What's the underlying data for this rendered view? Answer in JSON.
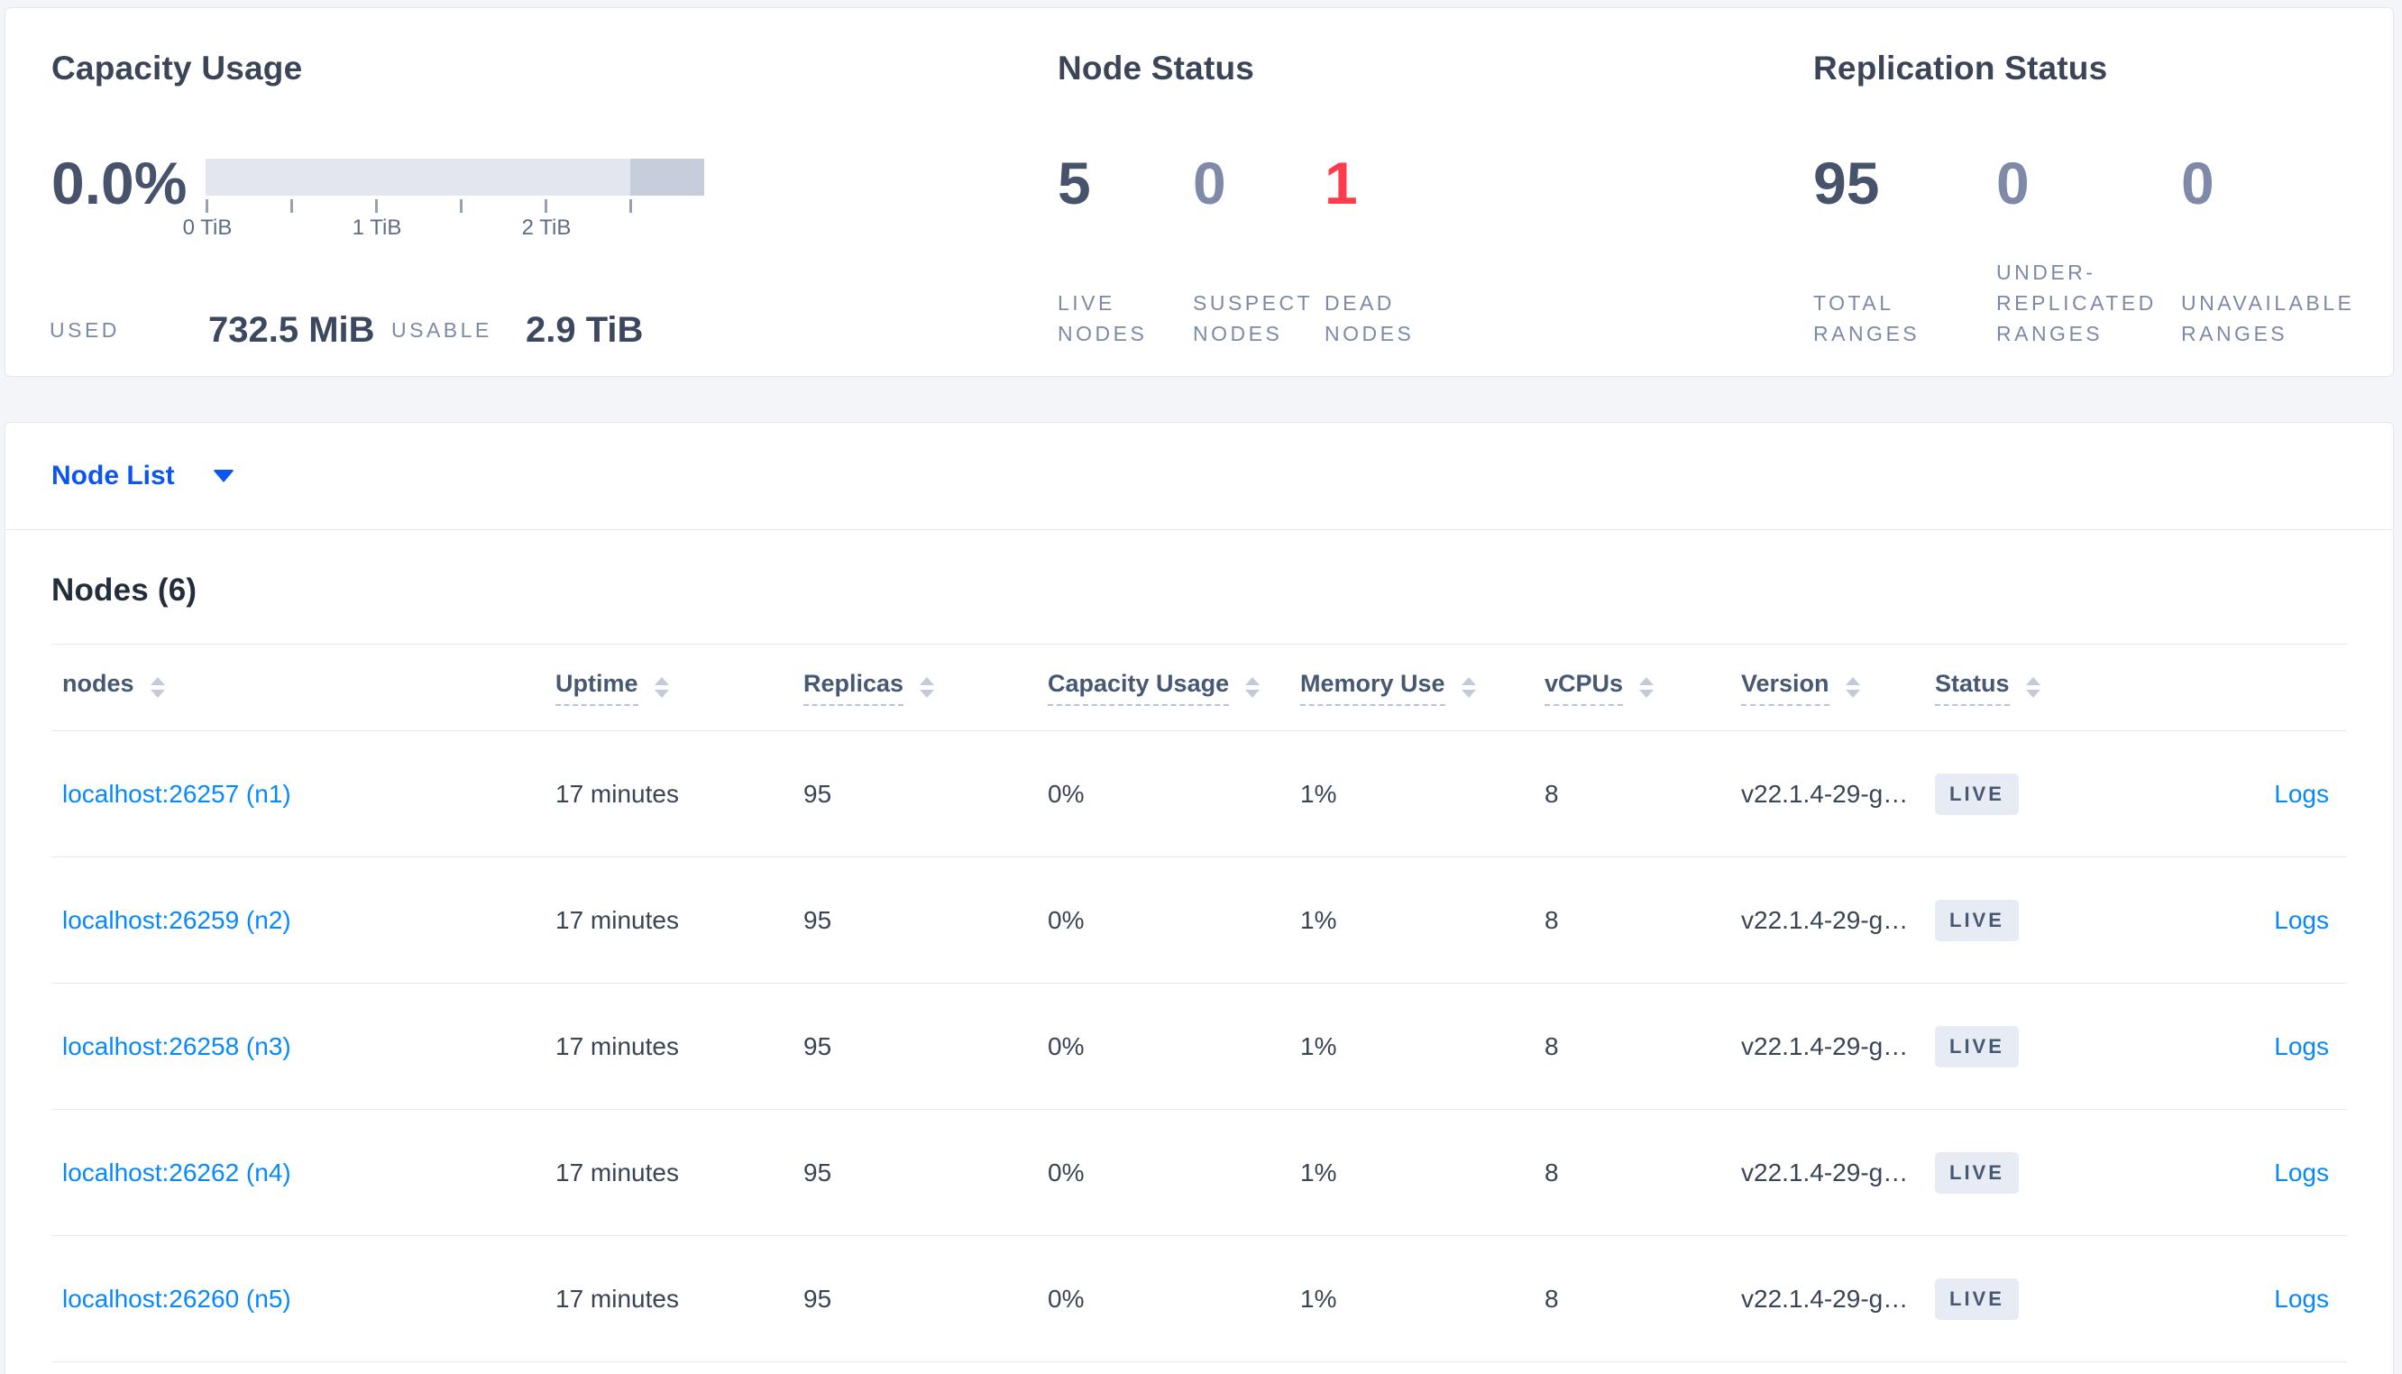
{
  "colors": {
    "accent_blue": "#0d55f0",
    "link_blue": "#0788ff",
    "danger_red": "#ff3b4e",
    "metric_strong": "#46536b",
    "metric_muted": "#7e8aa8",
    "badge_bg": "#e7ebf3",
    "page_bg": "#f4f5f9"
  },
  "summary": {
    "capacity": {
      "title": "Capacity Usage",
      "percent": "0.0%",
      "ticks": [
        "0 TiB",
        "1 TiB",
        "2 TiB"
      ],
      "used_label": "USED",
      "used_value": "732.5 MiB",
      "usable_label": "USABLE",
      "usable_value": "2.9 TiB"
    },
    "node_status": {
      "title": "Node Status",
      "metrics": [
        {
          "value": "5",
          "label": "LIVE NODES",
          "tone": "strong"
        },
        {
          "value": "0",
          "label": "SUSPECT NODES",
          "tone": "muted"
        },
        {
          "value": "1",
          "label": "DEAD NODES",
          "tone": "danger"
        }
      ]
    },
    "replication": {
      "title": "Replication Status",
      "metrics": [
        {
          "value": "95",
          "label": "TOTAL RANGES",
          "tone": "strong"
        },
        {
          "value": "0",
          "label": "UNDER-REPLICATED RANGES",
          "tone": "muted"
        },
        {
          "value": "0",
          "label": "UNAVAILABLE RANGES",
          "tone": "muted"
        }
      ]
    }
  },
  "node_list": {
    "selector_label": "Node List"
  },
  "nodes_section": {
    "heading": "Nodes (6)",
    "columns": [
      {
        "label": "nodes",
        "dashed": false
      },
      {
        "label": "Uptime",
        "dashed": true
      },
      {
        "label": "Replicas",
        "dashed": true
      },
      {
        "label": "Capacity Usage",
        "dashed": true
      },
      {
        "label": "Memory Use",
        "dashed": true
      },
      {
        "label": "vCPUs",
        "dashed": true
      },
      {
        "label": "Version",
        "dashed": true
      },
      {
        "label": "Status",
        "dashed": true
      }
    ],
    "rows": [
      {
        "node": "localhost:26257 (n1)",
        "uptime": "17 minutes",
        "replicas": "95",
        "capacity_usage": "0%",
        "memory_use": "1%",
        "vcpus": "8",
        "version": "v22.1.4-29-g…",
        "status": "LIVE",
        "logs": "Logs"
      },
      {
        "node": "localhost:26259 (n2)",
        "uptime": "17 minutes",
        "replicas": "95",
        "capacity_usage": "0%",
        "memory_use": "1%",
        "vcpus": "8",
        "version": "v22.1.4-29-g…",
        "status": "LIVE",
        "logs": "Logs"
      },
      {
        "node": "localhost:26258 (n3)",
        "uptime": "17 minutes",
        "replicas": "95",
        "capacity_usage": "0%",
        "memory_use": "1%",
        "vcpus": "8",
        "version": "v22.1.4-29-g…",
        "status": "LIVE",
        "logs": "Logs"
      },
      {
        "node": "localhost:26262 (n4)",
        "uptime": "17 minutes",
        "replicas": "95",
        "capacity_usage": "0%",
        "memory_use": "1%",
        "vcpus": "8",
        "version": "v22.1.4-29-g…",
        "status": "LIVE",
        "logs": "Logs"
      },
      {
        "node": "localhost:26260 (n5)",
        "uptime": "17 minutes",
        "replicas": "95",
        "capacity_usage": "0%",
        "memory_use": "1%",
        "vcpus": "8",
        "version": "v22.1.4-29-g…",
        "status": "LIVE",
        "logs": "Logs"
      }
    ]
  }
}
